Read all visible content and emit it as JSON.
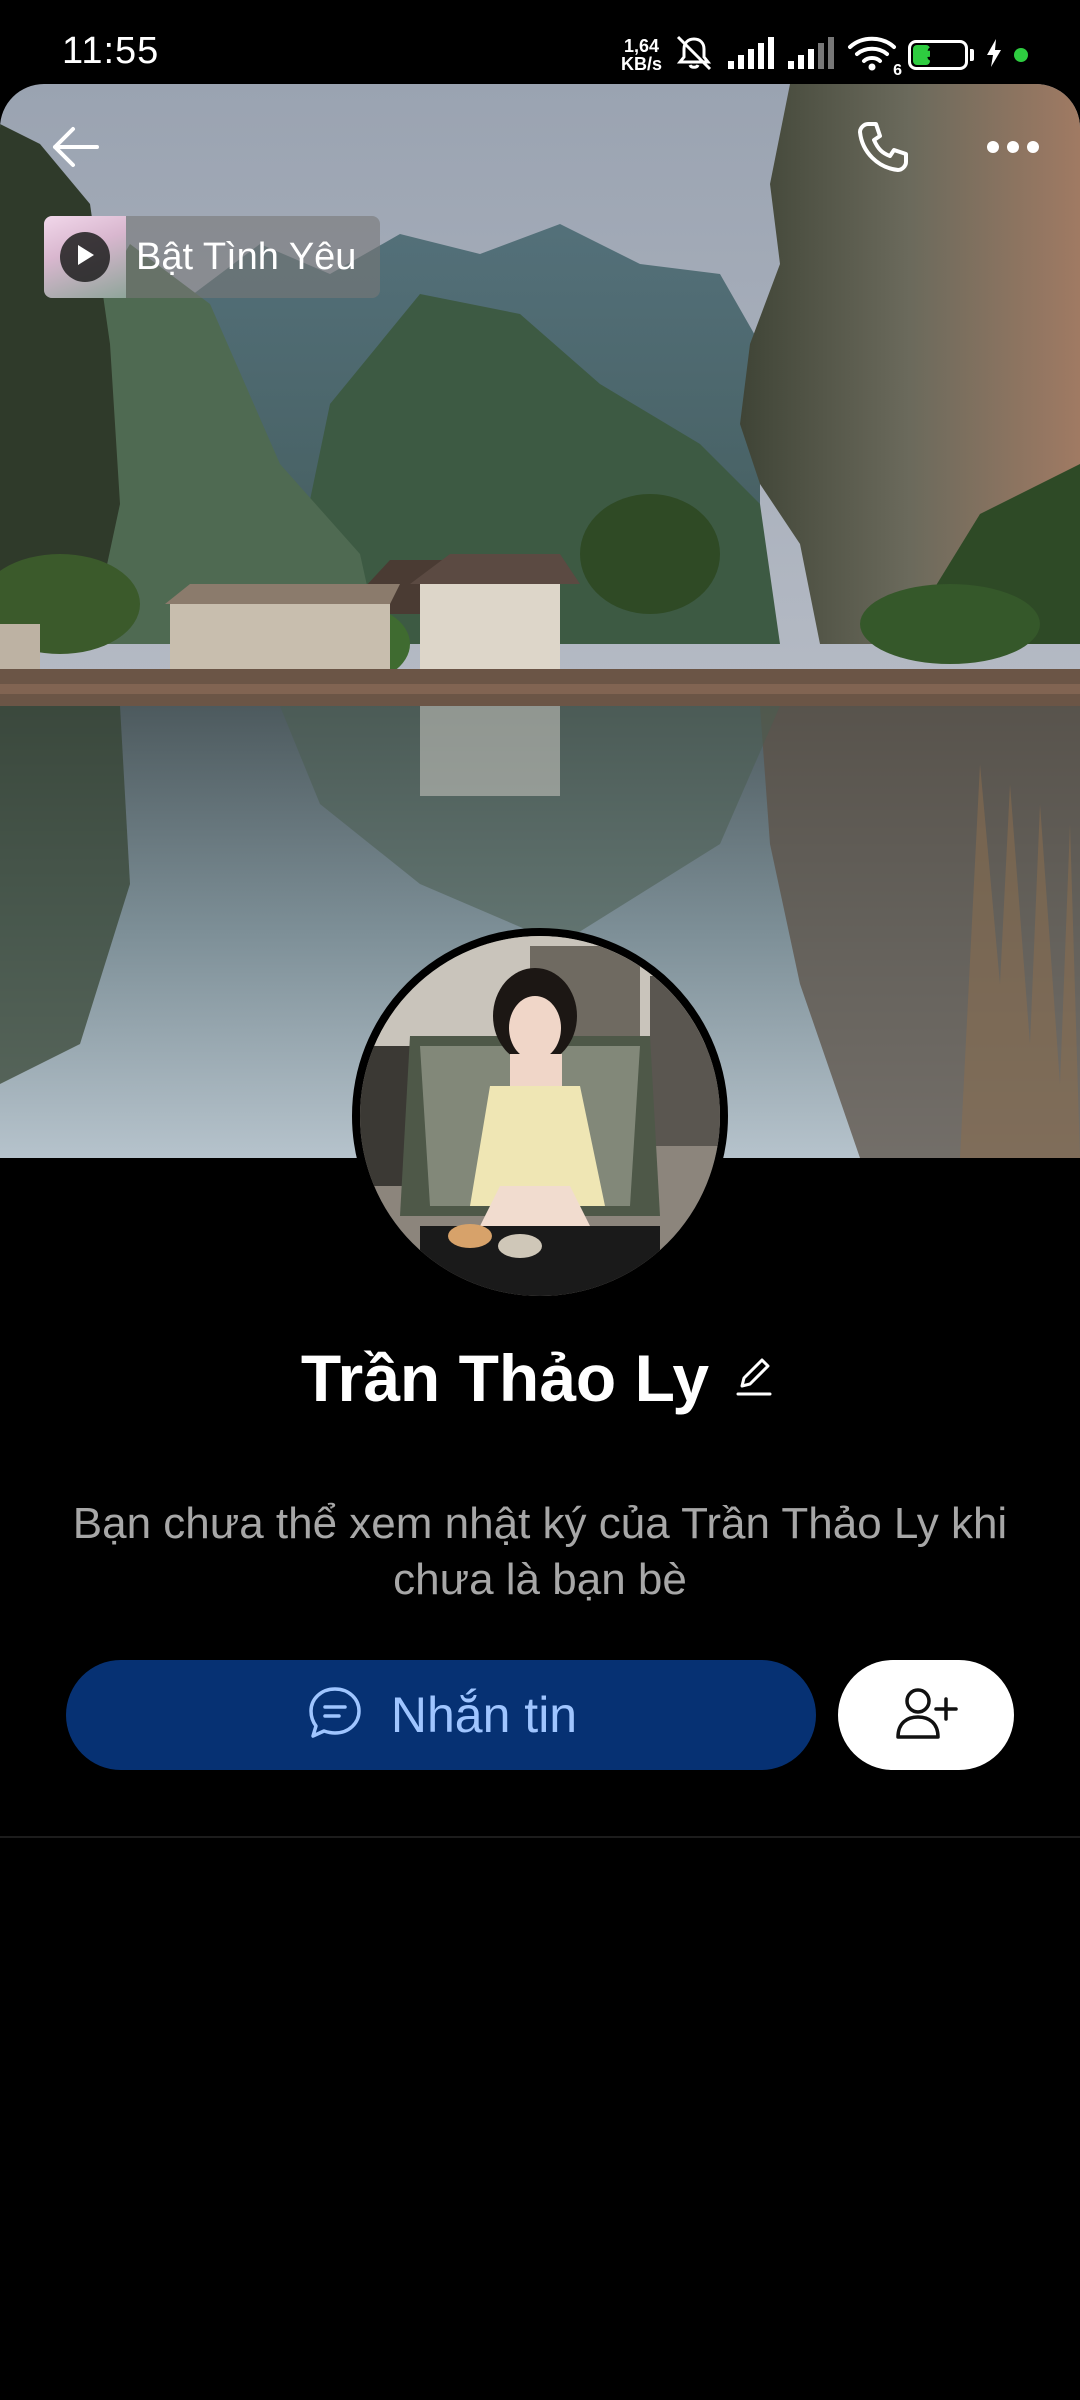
{
  "status_bar": {
    "time": "11:55",
    "net_speed_value": "1,64",
    "net_speed_unit": "KB/s",
    "battery_percent": "38",
    "battery_level": 0.38,
    "wifi_badge": "6",
    "icons": [
      "mute-icon",
      "signal-icon",
      "signal-icon-2",
      "wifi-icon",
      "battery-icon",
      "charging-icon"
    ]
  },
  "header": {
    "back_icon": "arrow-left-icon",
    "call_icon": "phone-icon",
    "more_icon": "more-dots-icon"
  },
  "music": {
    "title": "Bật Tình Yêu",
    "play_icon": "play-icon"
  },
  "profile": {
    "name": "Trần Thảo Ly",
    "edit_icon": "pencil-icon",
    "privacy_note": "Bạn chưa thể xem nhật ký của Trần Thảo Ly khi chưa là bạn bè"
  },
  "actions": {
    "message_label": "Nhắn tin",
    "message_icon": "chat-bubble-icon",
    "add_friend_icon": "add-user-icon"
  },
  "colors": {
    "background": "#000000",
    "message_button": "#063173",
    "message_text": "#9fc5ff",
    "note_text": "#a7a7a7"
  }
}
